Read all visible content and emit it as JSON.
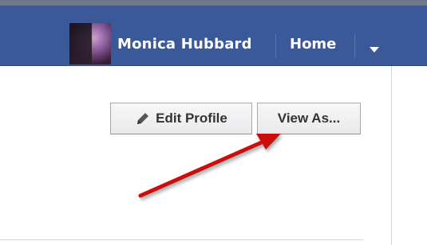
{
  "header": {
    "user_name": "Monica Hubbard",
    "nav_home": "Home",
    "avatar_icon": "profile-photo",
    "dropdown_icon": "chevron-down-icon",
    "bar_color": "#3b5998"
  },
  "profile_actions": {
    "edit_profile_label": "Edit Profile",
    "edit_profile_icon": "pencil-icon",
    "view_as_label": "View As..."
  },
  "annotation": {
    "arrow_color": "#cc1111",
    "arrow_icon": "red-arrow"
  }
}
